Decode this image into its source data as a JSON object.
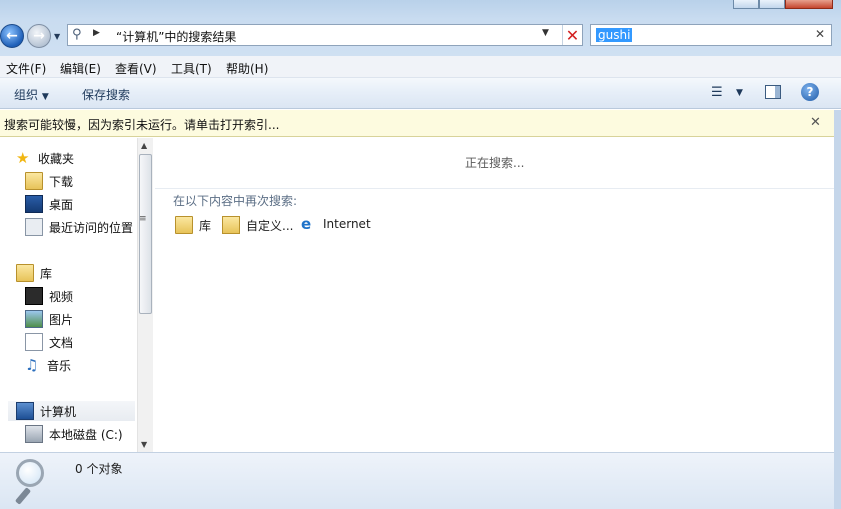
{
  "window": {
    "address": "“计算机”中的搜索结果",
    "search_value": "gushi"
  },
  "menubar": {
    "items": [
      "文件(F)",
      "编辑(E)",
      "查看(V)",
      "工具(T)",
      "帮助(H)"
    ]
  },
  "toolbar": {
    "organize": "组织",
    "save_search": "保存搜索"
  },
  "infobar": {
    "text": "搜索可能较慢，因为索引未运行。请单击打开索引..."
  },
  "nav": {
    "favorites": "收藏夹",
    "downloads": "下载",
    "desktop": "桌面",
    "recent": "最近访问的位置",
    "libraries": "库",
    "videos": "视频",
    "pictures": "图片",
    "documents": "文档",
    "music": "音乐",
    "computer": "计算机",
    "local_disk": "本地磁盘 (C:)"
  },
  "content": {
    "searching": "正在搜索...",
    "search_again_header": "在以下内容中再次搜索:",
    "search_again": [
      "库",
      "自定义...",
      "Internet"
    ]
  },
  "status": {
    "count": "0 个对象"
  },
  "icons": {
    "back": "back-arrow-icon",
    "forward": "forward-arrow-icon",
    "search": "magnifier-icon",
    "help": "help-icon"
  },
  "colors": {
    "accent": "#3399ff",
    "infobar_bg": "#fdfbdf",
    "chrome": "#c9dcf0"
  }
}
